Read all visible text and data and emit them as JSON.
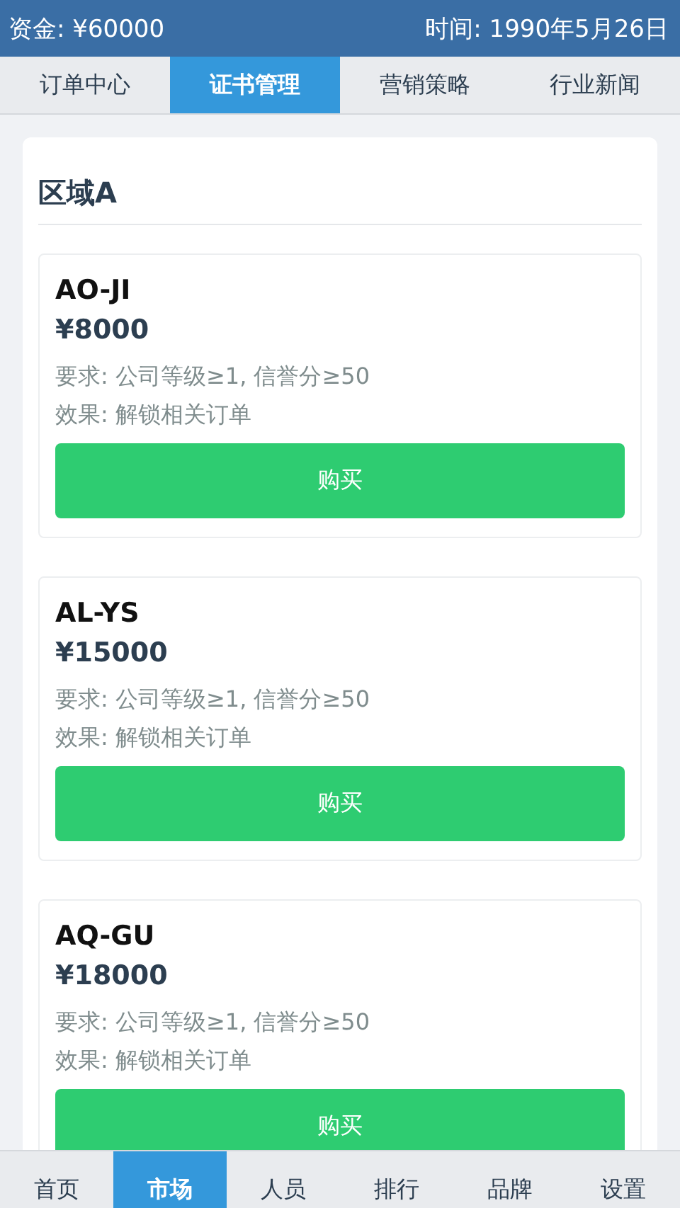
{
  "header": {
    "funds": "资金: ¥60000",
    "time": "时间: 1990年5月26日"
  },
  "tabs": [
    {
      "label": "订单中心",
      "selected": false
    },
    {
      "label": "证书管理",
      "selected": true
    },
    {
      "label": "营销策略",
      "selected": false
    },
    {
      "label": "行业新闻",
      "selected": false
    }
  ],
  "section": {
    "title": "区域A"
  },
  "certificates": [
    {
      "name": "AO-JI",
      "price": "¥8000",
      "requirement": "要求: 公司等级≥1, 信誉分≥50",
      "effect": "效果: 解锁相关订单",
      "button": "购买"
    },
    {
      "name": "AL-YS",
      "price": "¥15000",
      "requirement": "要求: 公司等级≥1, 信誉分≥50",
      "effect": "效果: 解锁相关订单",
      "button": "购买"
    },
    {
      "name": "AQ-GU",
      "price": "¥18000",
      "requirement": "要求: 公司等级≥1, 信誉分≥50",
      "effect": "效果: 解锁相关订单",
      "button": "购买"
    }
  ],
  "bottom_nav": [
    {
      "label": "首页",
      "selected": false
    },
    {
      "label": "市场",
      "selected": true
    },
    {
      "label": "人员",
      "selected": false
    },
    {
      "label": "排行",
      "selected": false
    },
    {
      "label": "品牌",
      "selected": false
    },
    {
      "label": "设置",
      "selected": false
    }
  ]
}
